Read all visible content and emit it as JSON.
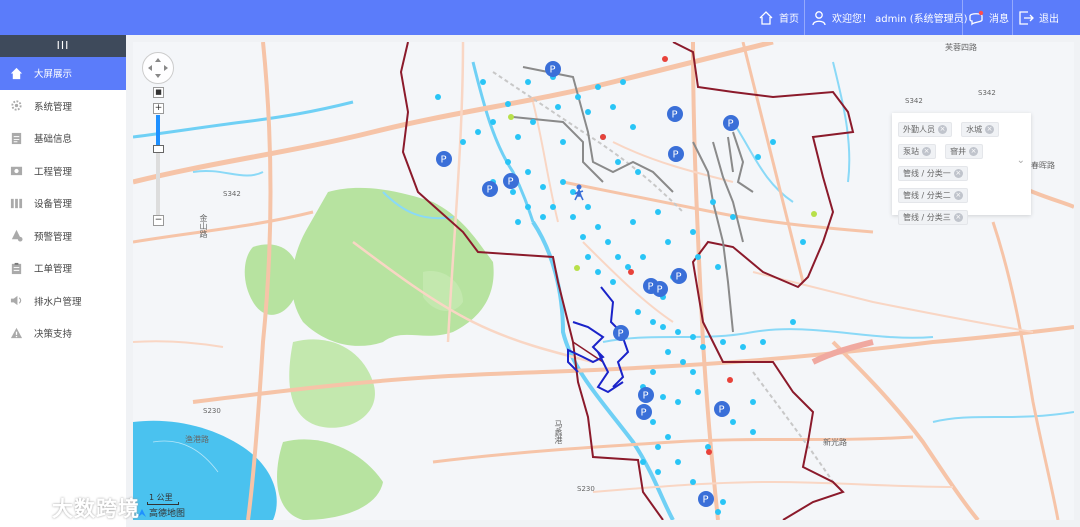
{
  "header": {
    "home_label": "首页",
    "welcome_label": "欢迎您！ admin (系统管理员)",
    "message_label": "消息",
    "logout_label": "退出"
  },
  "sidebar": {
    "toggle_label": "III",
    "items": [
      {
        "label": "大屏展示",
        "icon": "home-icon",
        "active": true
      },
      {
        "label": "系统管理",
        "icon": "gear-icon",
        "active": false
      },
      {
        "label": "基础信息",
        "icon": "document-icon",
        "active": false
      },
      {
        "label": "工程管理",
        "icon": "camera-icon",
        "active": false
      },
      {
        "label": "设备管理",
        "icon": "columns-icon",
        "active": false
      },
      {
        "label": "预警管理",
        "icon": "alert-icon",
        "active": false
      },
      {
        "label": "工单管理",
        "icon": "clipboard-icon",
        "active": false
      },
      {
        "label": "排水户管理",
        "icon": "speaker-icon",
        "active": false
      },
      {
        "label": "决策支持",
        "icon": "warning-icon",
        "active": false
      }
    ]
  },
  "map": {
    "filter_tags": [
      "外勤人员",
      "水城",
      "泵站",
      "窨井",
      "管线 / 分类一",
      "管线 / 分类二",
      "管线 / 分类三"
    ],
    "scale_label": "1 公里",
    "provider_label": "高德地图",
    "road_labels": [
      "芙蓉四路",
      "S342",
      "S342",
      "S342",
      "金山路",
      "S230",
      "渔港路",
      "马蠡港",
      "S230",
      "春晖路",
      "新光路"
    ]
  },
  "watermark": {
    "text": "大数跨境"
  },
  "colors": {
    "primary": "#5b7cfa",
    "sidebar_dark": "#3e4a5b",
    "boundary": "#8b1a2b",
    "pipe_blue": "#1a23c9",
    "pipe_gray": "#8a8a8a",
    "cyan_point": "#29c5f6",
    "parking": "#3a6fd8"
  }
}
